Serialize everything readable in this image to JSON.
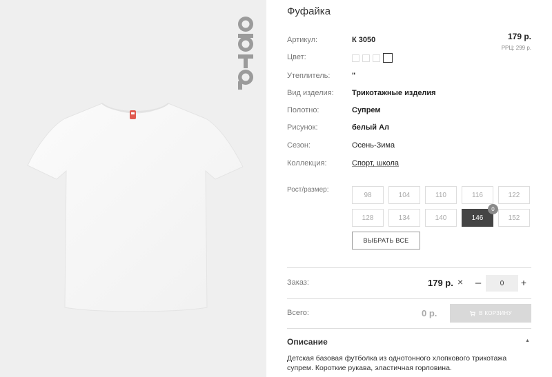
{
  "product": {
    "title": "Фуфайка",
    "price": "179 р.",
    "rrc": "РРЦ: 299 р.",
    "brand_logo_text": "OBTBO"
  },
  "specs": [
    {
      "label": "Артикул:",
      "value": "К 3050"
    },
    {
      "label": "Цвет:",
      "value": ""
    },
    {
      "label": "Утеплитель:",
      "value": "\""
    },
    {
      "label": "Вид изделия:",
      "value": "Трикотажные изделия"
    },
    {
      "label": "Полотно:",
      "value": "Супрем"
    },
    {
      "label": "Рисунок:",
      "value": "белый Ал"
    },
    {
      "label": "Сезон:",
      "value": "Осень-Зима"
    },
    {
      "label": "Коллекция:",
      "value": "Спорт, школа"
    }
  ],
  "colors": [
    "#ffffff",
    "#ffffff",
    "#ffffff",
    "#ffffff"
  ],
  "sizes": {
    "label": "Рост/размер:",
    "items": [
      "98",
      "104",
      "110",
      "116",
      "122",
      "128",
      "134",
      "140",
      "146",
      "152"
    ],
    "selected": "146",
    "selected_badge": "0",
    "select_all_label": "ВЫБРАТЬ ВСЕ"
  },
  "order": {
    "label": "Заказ:",
    "price": "179 р.",
    "times_symbol": "×",
    "minus": "–",
    "plus": "+",
    "quantity": "0"
  },
  "total": {
    "label": "Всего:",
    "value": "0 р.",
    "cart_button": "В КОРЗИНУ"
  },
  "description": {
    "title": "Описание",
    "text": "Детская базовая футболка из однотонного хлопкового трикотажа супрем. Короткие рукава, эластичная горловина."
  },
  "theme": {
    "image_bg": "#efefef",
    "active_size_bg": "#444444",
    "cart_disabled_bg": "#d9d9d9"
  }
}
